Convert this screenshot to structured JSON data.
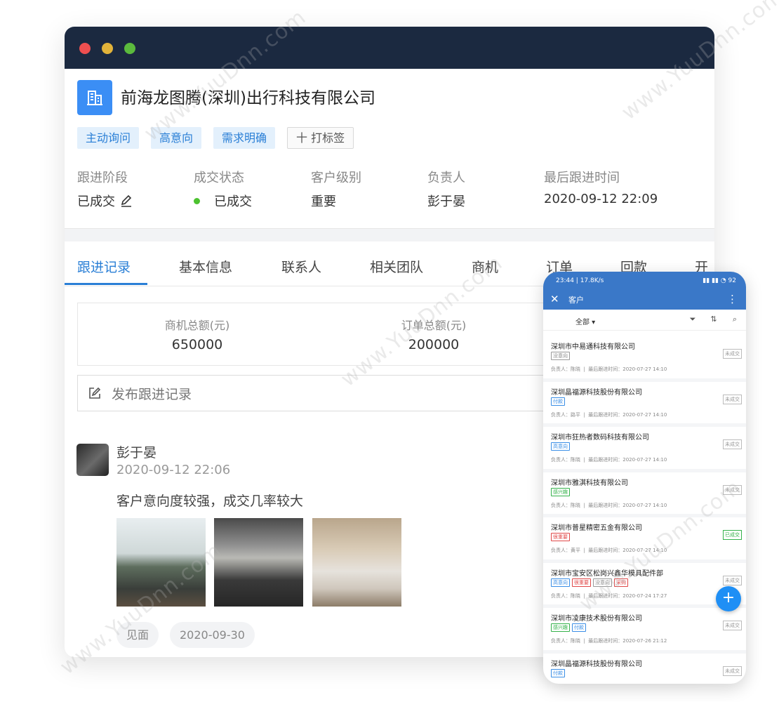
{
  "company": {
    "name": "前海龙图腾(深圳)出行科技有限公司",
    "tags": [
      "主动询问",
      "高意向",
      "需求明确"
    ],
    "add_tag_label": "十 打标签"
  },
  "fields": [
    {
      "label": "跟进阶段",
      "value": "已成交"
    },
    {
      "label": "成交状态",
      "value": "已成交"
    },
    {
      "label": "客户级别",
      "value": "重要"
    },
    {
      "label": "负责人",
      "value": "彭于晏"
    },
    {
      "label": "最后跟进时间",
      "value": "2020-09-12 22:09"
    }
  ],
  "tabs": [
    "跟进记录",
    "基本信息",
    "联系人",
    "相关团队",
    "商机",
    "订单",
    "回款",
    "开票"
  ],
  "stats": [
    {
      "label": "商机总额(元)",
      "value": "650000"
    },
    {
      "label": "订单总额(元)",
      "value": "200000"
    }
  ],
  "post_placeholder": "发布跟进记录",
  "entry": {
    "author": "彭于晏",
    "time": "2020-09-12 22:06",
    "text": "客户意向度较强，成交几率较大",
    "chips": [
      "见面",
      "2020-09-30"
    ]
  },
  "phone": {
    "status_time": "23:44 | 17.8K/s",
    "status_icons": "▮▮ ▮▮ ◔ 92",
    "title": "客户",
    "filter_all": "全部",
    "customers": [
      {
        "name": "深圳市中易通科技有限公司",
        "tags": [
          {
            "t": "没意向",
            "c": "grey"
          }
        ],
        "owner": "负责人：陈晓",
        "last": "最后跟进时间：2020-07-27 14:10",
        "status": "未成交",
        "done": false
      },
      {
        "name": "深圳晶福源科技股份有限公司",
        "tags": [
          {
            "t": "付款",
            "c": "blue"
          }
        ],
        "owner": "负责人：路平",
        "last": "最后跟进时间：2020-07-27 14:10",
        "status": "未成交",
        "done": false
      },
      {
        "name": "深圳市狂热者数码科技有限公司",
        "tags": [
          {
            "t": "高意向",
            "c": "blue"
          }
        ],
        "owner": "负责人：陈晓",
        "last": "最后跟进时间：2020-07-27 14:10",
        "status": "未成交",
        "done": false
      },
      {
        "name": "深圳市雅淇科技有限公司",
        "tags": [
          {
            "t": "感兴趣",
            "c": "green"
          }
        ],
        "owner": "负责人：陈晓",
        "last": "最后跟进时间：2020-07-27 14:10",
        "status": "未成交",
        "done": false
      },
      {
        "name": "深圳市普星精密五金有限公司",
        "tags": [
          {
            "t": "很重要",
            "c": "red"
          }
        ],
        "owner": "负责人：黄平",
        "last": "最后跟进时间：2020-07-27 14:10",
        "status": "已成交",
        "done": true
      },
      {
        "name": "深圳市宝安区松岗兴鑫华模具配件部",
        "tags": [
          {
            "t": "高意向",
            "c": "blue"
          },
          {
            "t": "很重要",
            "c": "red"
          },
          {
            "t": "没意向",
            "c": "grey"
          },
          {
            "t": "采购",
            "c": "red"
          }
        ],
        "owner": "负责人：陈晓",
        "last": "最后跟进时间：2020-07-24 17:27",
        "status": "未成交",
        "done": false
      },
      {
        "name": "深圳市凌康技术股份有限公司",
        "tags": [
          {
            "t": "感兴趣",
            "c": "green"
          },
          {
            "t": "付款",
            "c": "blue"
          }
        ],
        "owner": "负责人：陈晓",
        "last": "最后跟进时间：2020-07-26 21:12",
        "status": "未成交",
        "done": false
      },
      {
        "name": "深圳晶福源科技股份有限公司",
        "tags": [
          {
            "t": "付款",
            "c": "blue"
          }
        ],
        "owner": "",
        "last": "",
        "status": "未成交",
        "done": false
      }
    ]
  },
  "colors": {
    "titlebar": "#1b2940",
    "accent": "#2a7fd6",
    "phone_header": "#3a78c8",
    "success": "#4cc22f"
  }
}
